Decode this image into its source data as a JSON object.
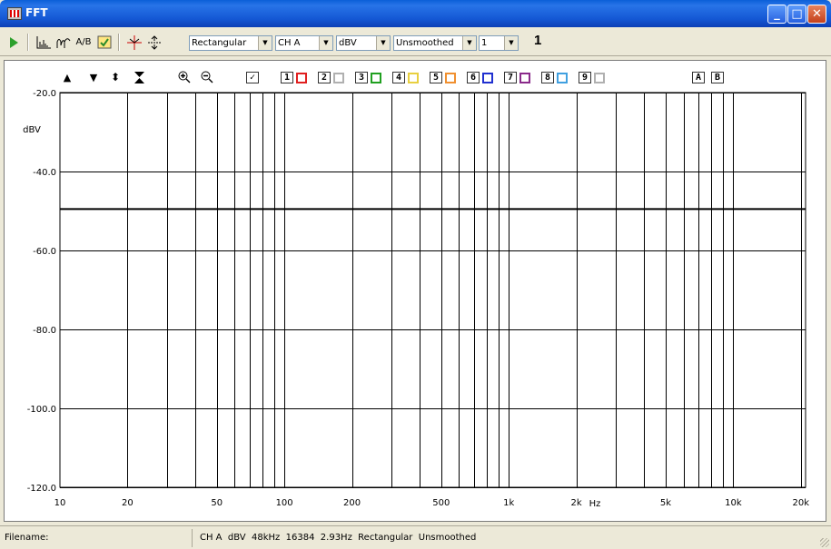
{
  "window": {
    "title": "FFT",
    "minimize": "_",
    "maximize": "□",
    "close": "✕"
  },
  "toolbar": {
    "window_type": "Rectangular",
    "channel": "CH A",
    "units": "dBV",
    "smoothing": "Unsmoothed",
    "average_count": "1",
    "average_display": "1"
  },
  "plot": {
    "y_label": "dBV",
    "x_unit": "Hz",
    "trace_selected": "✓",
    "traces": [
      {
        "label": "1",
        "color": "#e02020"
      },
      {
        "label": "2",
        "color": "#b0b0b0"
      },
      {
        "label": "3",
        "color": "#20a020"
      },
      {
        "label": "4",
        "color": "#e8d040"
      },
      {
        "label": "5",
        "color": "#f09030"
      },
      {
        "label": "6",
        "color": "#2030d0"
      },
      {
        "label": "7",
        "color": "#8a2a8a"
      },
      {
        "label": "8",
        "color": "#40a0e0"
      },
      {
        "label": "9",
        "color": "#b0b0b0"
      }
    ],
    "ref_a": "A",
    "ref_b": "B"
  },
  "chart_data": {
    "type": "line",
    "title": "",
    "xlabel": "Hz",
    "ylabel": "dBV",
    "x_scale": "log",
    "xlim": [
      10,
      21000
    ],
    "ylim": [
      -120,
      -20
    ],
    "y_ticks": [
      -20,
      -40,
      -60,
      -80,
      -100,
      -120
    ],
    "y_tick_labels": [
      "-20.0",
      "-40.0",
      "-60.0",
      "-80.0",
      "-100.0",
      "-120.0"
    ],
    "x_ticks": [
      10,
      20,
      50,
      100,
      200,
      500,
      1000,
      2000,
      5000,
      10000,
      20000
    ],
    "x_tick_labels": [
      "10",
      "20",
      "50",
      "100",
      "200",
      "500",
      "1k",
      "2k",
      "5k",
      "10k",
      "20k"
    ],
    "grid": true,
    "series": [
      {
        "x": [
          10,
          21000
        ],
        "y": [
          -49.5,
          -49.5
        ]
      }
    ]
  },
  "status": {
    "filename_label": "Filename:",
    "info": "CH A  dBV  48kHz  16384  2.93Hz  Rectangular  Unsmoothed"
  }
}
